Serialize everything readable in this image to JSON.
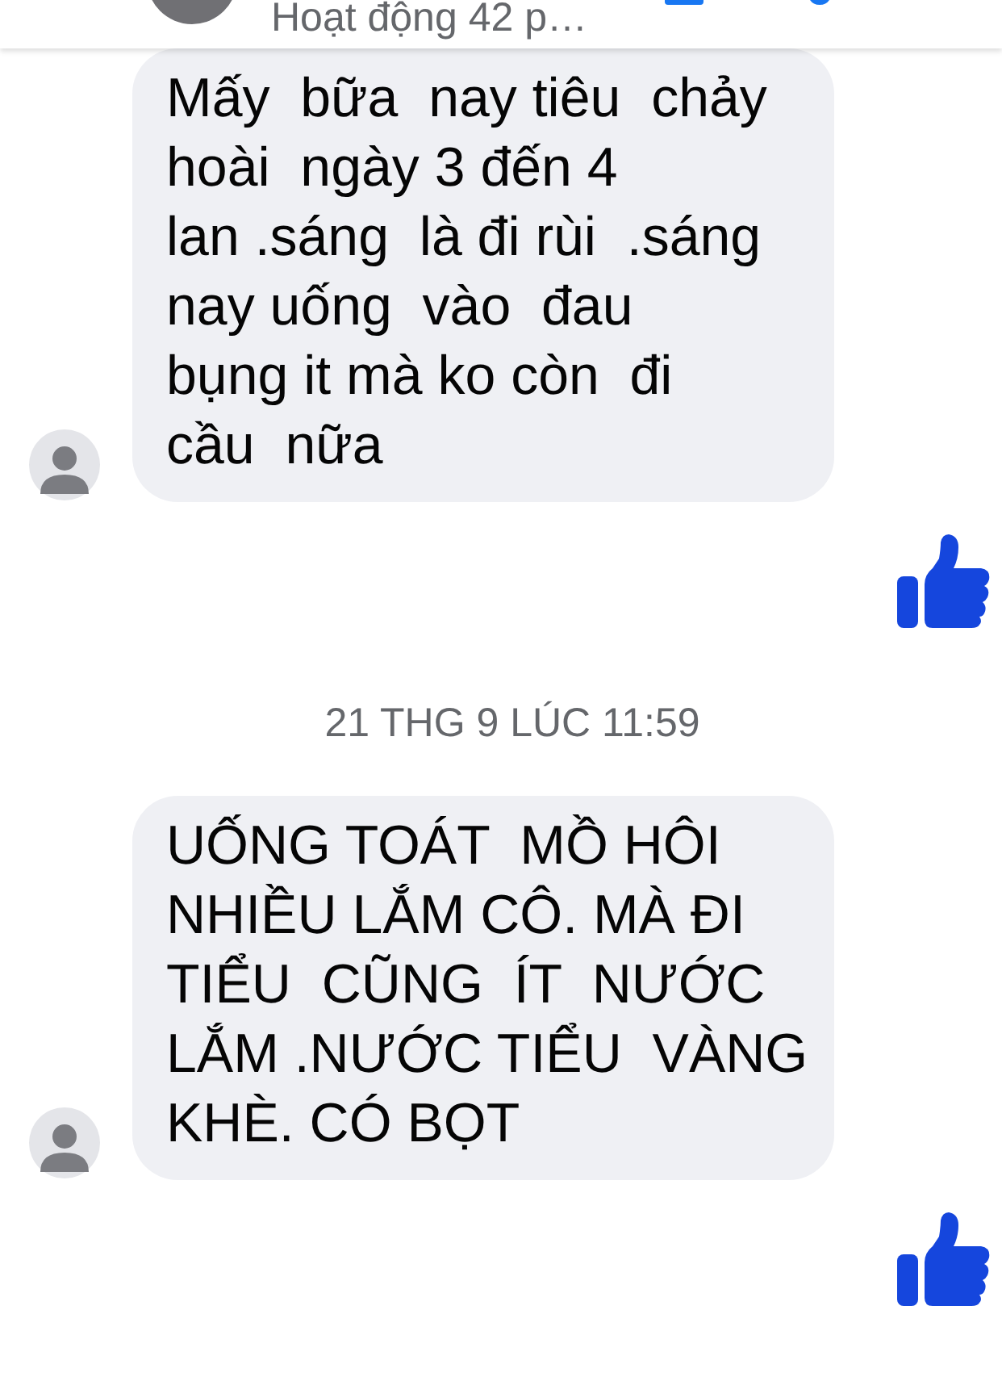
{
  "header": {
    "status": "Hoạt động 42 p…"
  },
  "messages": [
    {
      "kind": "incoming",
      "text": "Mấy  bữa  nay tiêu  chảy\nhoài  ngày 3 đến 4\nlan .sáng  là đi rùi  .sáng\nnay uống  vào  đau\nbụng it mà ko còn  đi\ncầu  nữa"
    },
    {
      "kind": "like"
    },
    {
      "kind": "timestamp",
      "text": "21 THG 9 LÚC 11:59"
    },
    {
      "kind": "incoming",
      "text": "UỐNG TOÁT  MỒ HÔI\nNHIỀU LẮM CÔ. MÀ ĐI\nTIỂU  CŨNG  ÍT  NƯỚC\nLẮM .NƯỚC TIỂU  VÀNG\nKHÈ. CÓ BỌT"
    },
    {
      "kind": "like"
    }
  ]
}
